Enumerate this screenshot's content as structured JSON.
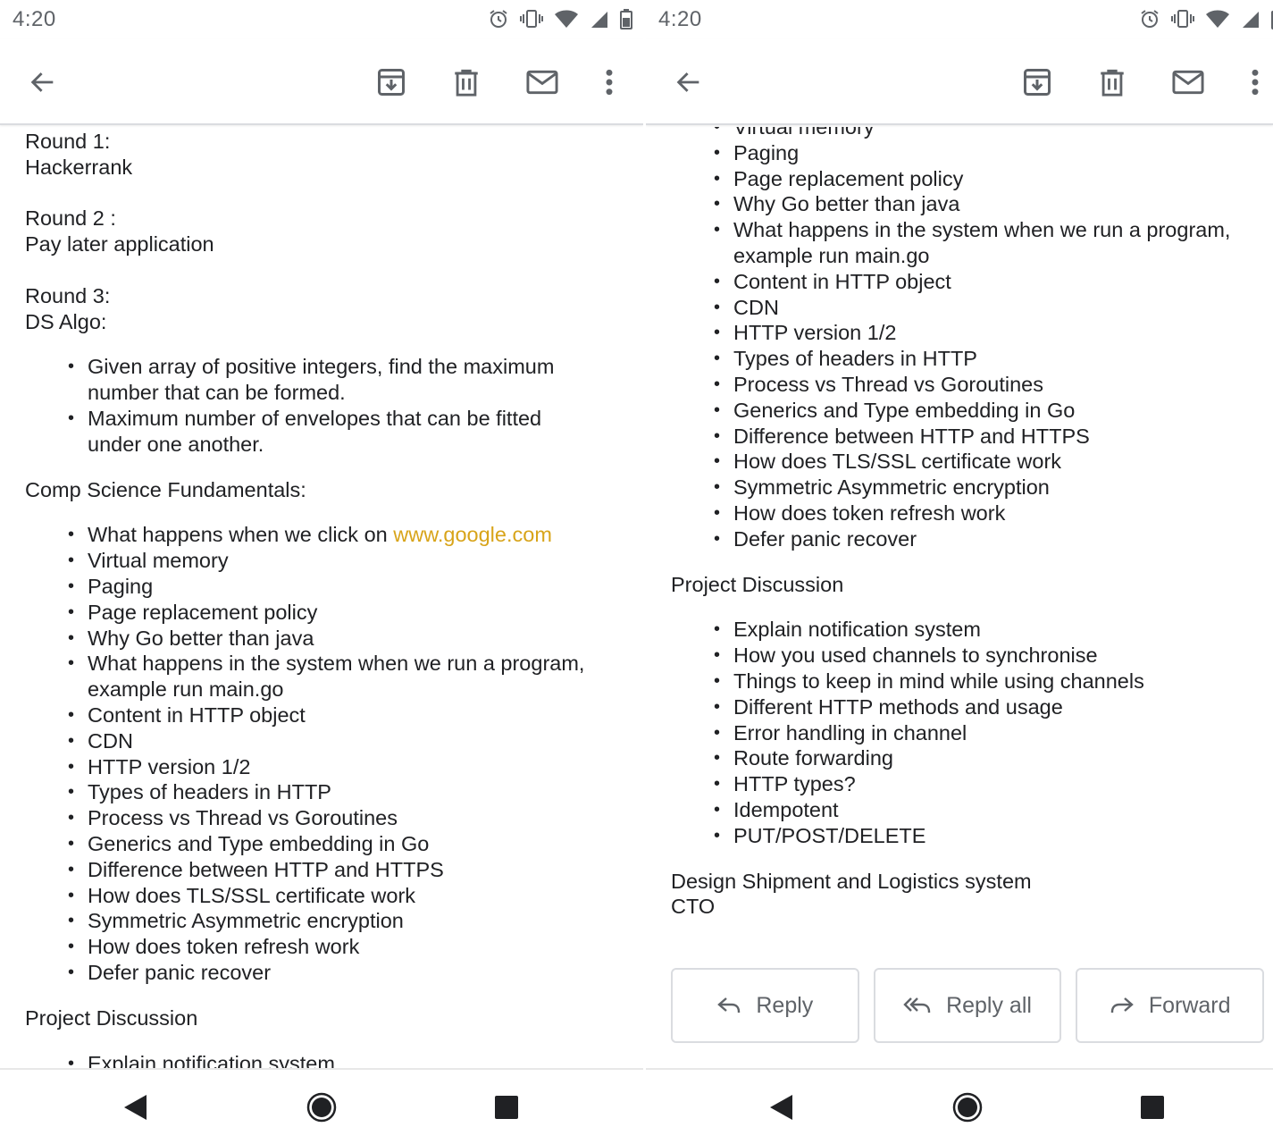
{
  "colors": {
    "text": "#202124",
    "icon": "#5f6368",
    "link": "#d8a41a",
    "divider": "#dadce0"
  },
  "left": {
    "status": {
      "time": "4:20",
      "icons": [
        "alarm-icon",
        "vibrate-icon",
        "wifi-icon",
        "signal-icon",
        "battery-icon"
      ]
    },
    "toolbar": {
      "icons": [
        "back-arrow-icon",
        "archive-icon",
        "delete-icon",
        "mail-icon",
        "more-vert-icon"
      ]
    },
    "body": {
      "round1_title": "Round 1:",
      "round1_detail": "Hackerrank",
      "round2_title": "Round 2 :",
      "round2_detail": "Pay later application",
      "round3_title": "Round 3:",
      "round3_detail": "DS Algo:",
      "ds_items": [
        "Given array of positive integers, find the maximum number that can be formed.",
        "Maximum number of envelopes that can be fitted under one another."
      ],
      "cs_heading": "Comp Science Fundamentals:",
      "cs_first_prefix": "What happens when we click on ",
      "cs_first_link": "www.google.com",
      "cs_items": [
        "Virtual memory",
        "Paging",
        "Page replacement policy",
        "Why Go better than java",
        "What happens in the system when we run a program, example run main.go",
        "Content in HTTP object",
        "CDN",
        "HTTP version 1/2",
        "Types of headers in HTTP",
        "Process vs Thread vs Goroutines",
        "Generics and Type embedding in Go",
        "Difference between HTTP and HTTPS",
        "How does TLS/SSL certificate work",
        "Symmetric Asymmetric encryption",
        "How does token refresh work",
        "Defer panic recover"
      ],
      "project_heading": "Project Discussion",
      "project_items_visible": [
        "Explain notification system"
      ]
    },
    "navbar": {
      "icons": [
        "nav-back-icon",
        "nav-home-icon",
        "nav-recent-icon"
      ]
    }
  },
  "right": {
    "status": {
      "time": "4:20",
      "icons": [
        "alarm-icon",
        "vibrate-icon",
        "wifi-icon",
        "signal-icon",
        "battery-icon"
      ]
    },
    "toolbar": {
      "icons": [
        "back-arrow-icon",
        "archive-icon",
        "delete-icon",
        "mail-icon",
        "more-vert-icon"
      ]
    },
    "body": {
      "cs_items": [
        "Virtual memory",
        "Paging",
        "Page replacement policy",
        "Why Go better than java",
        "What happens in the system when we run a program, example run main.go",
        "Content in HTTP object",
        "CDN",
        "HTTP version 1/2",
        "Types of headers in HTTP",
        "Process vs Thread vs Goroutines",
        "Generics and Type embedding in Go",
        "Difference between HTTP and HTTPS",
        "How does TLS/SSL certificate work",
        "Symmetric Asymmetric encryption",
        "How does token refresh work",
        "Defer panic recover"
      ],
      "project_heading": "Project Discussion",
      "project_items": [
        "Explain notification system",
        "How you used channels to synchronise",
        "Things to keep in mind while using channels",
        "Different HTTP methods and usage",
        "Error handling in channel",
        "Route forwarding",
        "HTTP types?",
        "Idempotent",
        "PUT/POST/DELETE"
      ],
      "design_line": "Design Shipment and Logistics system",
      "cto_line": "CTO"
    },
    "actions": {
      "reply": "Reply",
      "reply_all": "Reply all",
      "forward": "Forward"
    },
    "navbar": {
      "icons": [
        "nav-back-icon",
        "nav-home-icon",
        "nav-recent-icon"
      ]
    }
  }
}
